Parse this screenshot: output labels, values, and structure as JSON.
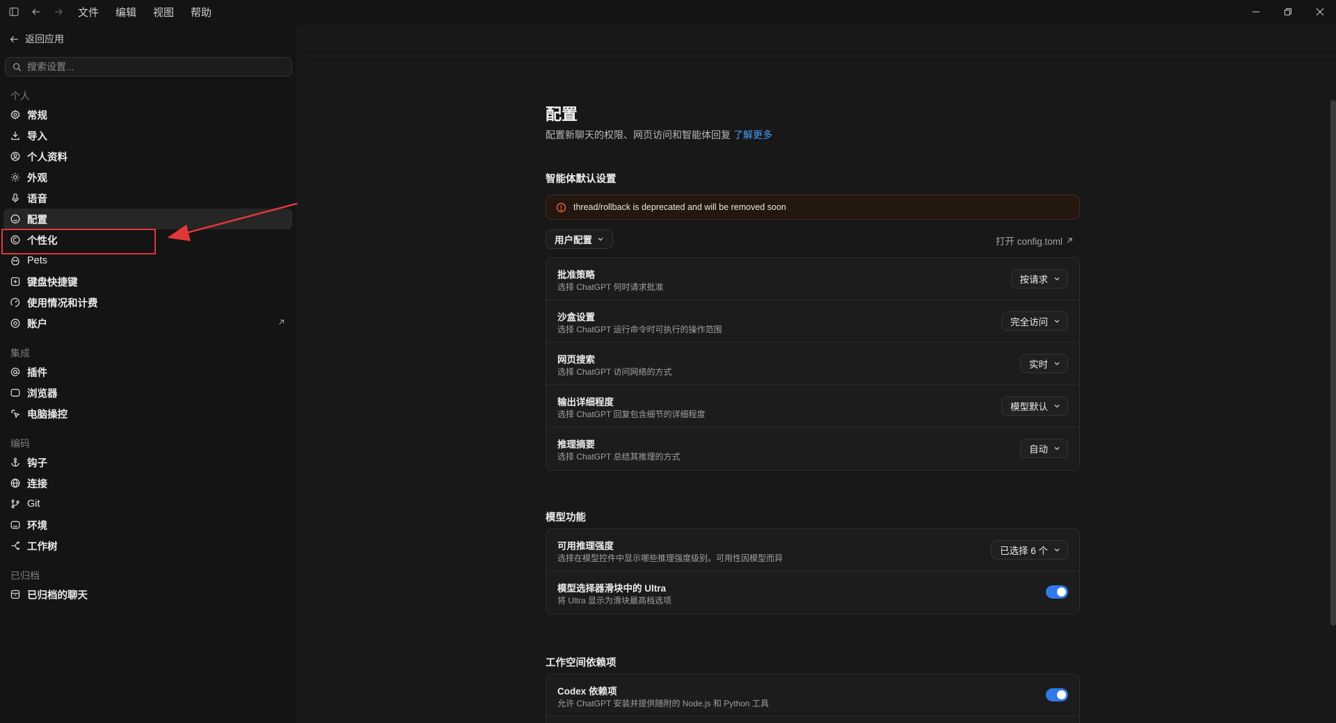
{
  "menu": [
    "文件",
    "编辑",
    "视图",
    "帮助"
  ],
  "sidebar": {
    "back_label": "返回应用",
    "search_placeholder": "搜索设置...",
    "sections": {
      "personal": "个人",
      "integrations": "集成",
      "coding": "编码",
      "archived": "已归档"
    },
    "items": {
      "general": "常规",
      "import": "导入",
      "profile": "个人资料",
      "appearance": "外观",
      "voice": "语音",
      "config": "配置",
      "personalization": "个性化",
      "pets": "Pets",
      "shortcuts": "键盘快捷键",
      "usage": "使用情况和计费",
      "account": "账户",
      "plugins": "插件",
      "browser": "浏览器",
      "computer_control": "电脑操控",
      "hooks": "钩子",
      "connections": "连接",
      "git": "Git",
      "environment": "环境",
      "worktree": "工作树",
      "archived_chats": "已归档的聊天"
    }
  },
  "main": {
    "title": "配置",
    "subtitle": "配置新聊天的权限、网页访问和智能体回复",
    "learn_more": "了解更多",
    "agent_defaults": {
      "heading": "智能体默认设置",
      "warning": "thread/rollback is deprecated and will be removed soon",
      "profile_dropdown": "用户配置",
      "open_config": "打开 config.toml",
      "rows": [
        {
          "title": "批准策略",
          "desc": "选择 ChatGPT 何时请求批准",
          "value": "按请求"
        },
        {
          "title": "沙盒设置",
          "desc": "选择 ChatGPT 运行命令时可执行的操作范围",
          "value": "完全访问"
        },
        {
          "title": "网页搜索",
          "desc": "选择 ChatGPT 访问网络的方式",
          "value": "实时"
        },
        {
          "title": "输出详细程度",
          "desc": "选择 ChatGPT 回复包含细节的详细程度",
          "value": "模型默认"
        },
        {
          "title": "推理摘要",
          "desc": "选择 ChatGPT 总结其推理的方式",
          "value": "自动"
        }
      ]
    },
    "model_features": {
      "heading": "模型功能",
      "rows": [
        {
          "title": "可用推理强度",
          "desc": "选择在模型控件中显示哪些推理强度级别。可用性因模型而异",
          "value": "已选择 6 个"
        },
        {
          "title": "模型选择器滑块中的 Ultra",
          "desc": "将 Ultra 显示为滑块最高档选项",
          "toggle": true
        }
      ]
    },
    "workspace_deps": {
      "heading": "工作空间依赖项",
      "rows": [
        {
          "title": "Codex 依赖项",
          "desc": "允许 ChatGPT 安装并提供随附的 Node.js 和 Python 工具",
          "toggle": true
        }
      ]
    }
  },
  "colors": {
    "accent": "#2f7ae5",
    "link": "#4a9eff",
    "annotation": "#e0373a"
  }
}
